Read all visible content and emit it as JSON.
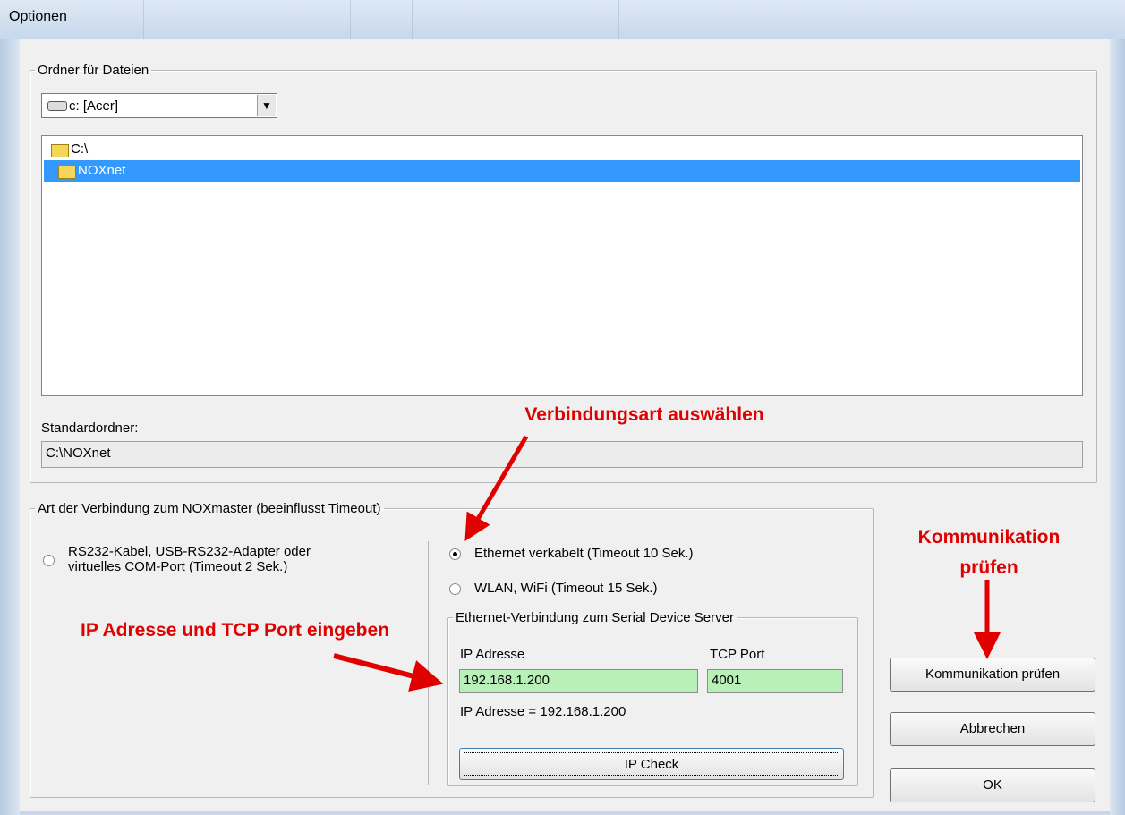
{
  "window": {
    "title": "Optionen"
  },
  "folders": {
    "group_label": "Ordner für Dateien",
    "drive": "c: [Acer]",
    "dropdown_glyph": "▼",
    "tree": [
      {
        "label": "C:\\",
        "selected": false
      },
      {
        "label": "NOXnet",
        "selected": true
      }
    ],
    "default_label": "Standardordner:",
    "default_value": "C:\\NOXnet"
  },
  "connection": {
    "group_label": "Art der Verbindung zum NOXmaster (beeinflusst Timeout)",
    "options": [
      {
        "label_line1": "RS232-Kabel, USB-RS232-Adapter oder",
        "label_line2": "virtuelles COM-Port (Timeout 2 Sek.)",
        "checked": false
      },
      {
        "label": "Ethernet verkabelt (Timeout 10 Sek.)",
        "checked": true
      },
      {
        "label": "WLAN, WiFi (Timeout 15 Sek.)",
        "checked": false
      }
    ],
    "ethernet": {
      "group_label": "Ethernet-Verbindung zum Serial Device Server",
      "ip_label": "IP Adresse",
      "ip_value": "192.168.1.200",
      "port_label": "TCP Port",
      "port_value": "4001",
      "status": "IP Adresse = 192.168.1.200",
      "check_button": "IP Check"
    }
  },
  "buttons": {
    "test": "Kommunikation prüfen",
    "cancel": "Abbrechen",
    "ok": "OK"
  },
  "annotations": {
    "select_type": "Verbindungsart auswählen",
    "test_line1": "Kommunikation",
    "test_line2": "prüfen",
    "enter_ip": "IP Adresse und TCP Port eingeben",
    "color": "#e00000"
  }
}
